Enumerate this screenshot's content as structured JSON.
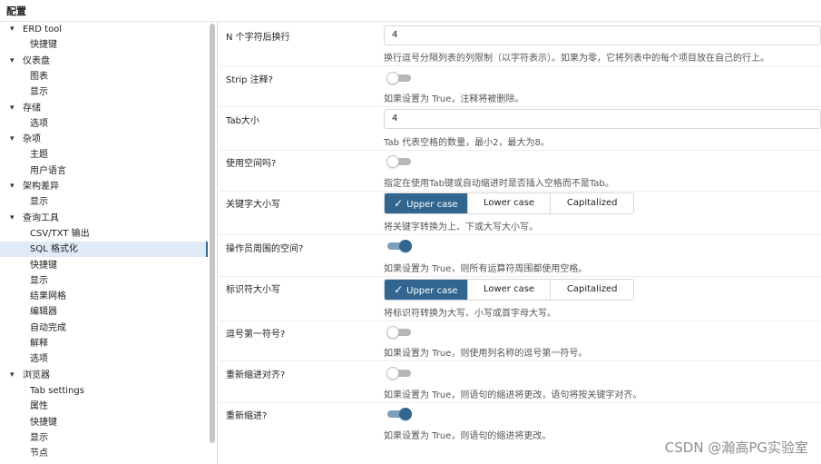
{
  "window": {
    "title": "配置"
  },
  "sidebar": {
    "items": [
      {
        "label": "ERD tool",
        "type": "parent"
      },
      {
        "label": "快捷键",
        "type": "child"
      },
      {
        "label": "仪表盘",
        "type": "parent"
      },
      {
        "label": "图表",
        "type": "child"
      },
      {
        "label": "显示",
        "type": "child"
      },
      {
        "label": "存储",
        "type": "parent"
      },
      {
        "label": "选项",
        "type": "child"
      },
      {
        "label": "杂项",
        "type": "parent"
      },
      {
        "label": "主题",
        "type": "child"
      },
      {
        "label": "用户语言",
        "type": "child"
      },
      {
        "label": "架构差异",
        "type": "parent"
      },
      {
        "label": "显示",
        "type": "child"
      },
      {
        "label": "查询工具",
        "type": "parent"
      },
      {
        "label": "CSV/TXT 输出",
        "type": "child"
      },
      {
        "label": "SQL 格式化",
        "type": "child",
        "selected": true
      },
      {
        "label": "快捷键",
        "type": "child"
      },
      {
        "label": "显示",
        "type": "child"
      },
      {
        "label": "结果网格",
        "type": "child"
      },
      {
        "label": "编辑器",
        "type": "child"
      },
      {
        "label": "自动完成",
        "type": "child"
      },
      {
        "label": "解释",
        "type": "child"
      },
      {
        "label": "选项",
        "type": "child"
      },
      {
        "label": "浏览器",
        "type": "parent"
      },
      {
        "label": "Tab settings",
        "type": "child"
      },
      {
        "label": "属性",
        "type": "child"
      },
      {
        "label": "快捷键",
        "type": "child"
      },
      {
        "label": "显示",
        "type": "child"
      },
      {
        "label": "节点",
        "type": "child"
      }
    ]
  },
  "settings": {
    "wrap_after": {
      "label": "N 个字符后换行",
      "value": "4",
      "help": "换行逗号分隔列表的列限制（以字符表示）。如果为零，它将列表中的每个项目放在自己的行上。"
    },
    "strip_comments": {
      "label": "Strip 注释?",
      "on": false,
      "help": "如果设置为 True，注释将被删除。"
    },
    "tab_size": {
      "label": "Tab大小",
      "value": "4",
      "help": "Tab 代表空格的数量，最小2，最大为8。"
    },
    "use_spaces": {
      "label": "使用空间吗?",
      "on": false,
      "help": "指定在使用Tab键或自动缩进时是否插入空格而不是Tab。"
    },
    "keyword_case": {
      "label": "关键字大小写",
      "options": [
        "Upper case",
        "Lower case",
        "Capitalized"
      ],
      "selected": "Upper case",
      "help": "将关键字转换为上、下或大写大小写。"
    },
    "operator_spaces": {
      "label": "操作员周围的空间?",
      "on": true,
      "help": "如果设置为 True，则所有运算符周围都使用空格。"
    },
    "identifier_case": {
      "label": "标识符大小写",
      "options": [
        "Upper case",
        "Lower case",
        "Capitalized"
      ],
      "selected": "Upper case",
      "help": "将标识符转换为大写、小写或首字母大写。"
    },
    "comma_first": {
      "label": "逗号第一符号?",
      "on": false,
      "help": "如果设置为 True，则使用列名称的逗号第一符号。"
    },
    "reindent_aligned": {
      "label": "重新缩进对齐?",
      "on": false,
      "help": "如果设置为 True，则语句的缩进将更改，语句将按关键字对齐。"
    },
    "reindent": {
      "label": "重新缩进?",
      "on": true,
      "help": "如果设置为 True，则语句的缩进将更改。"
    }
  },
  "watermark": "CSDN @瀚高PG实验室"
}
